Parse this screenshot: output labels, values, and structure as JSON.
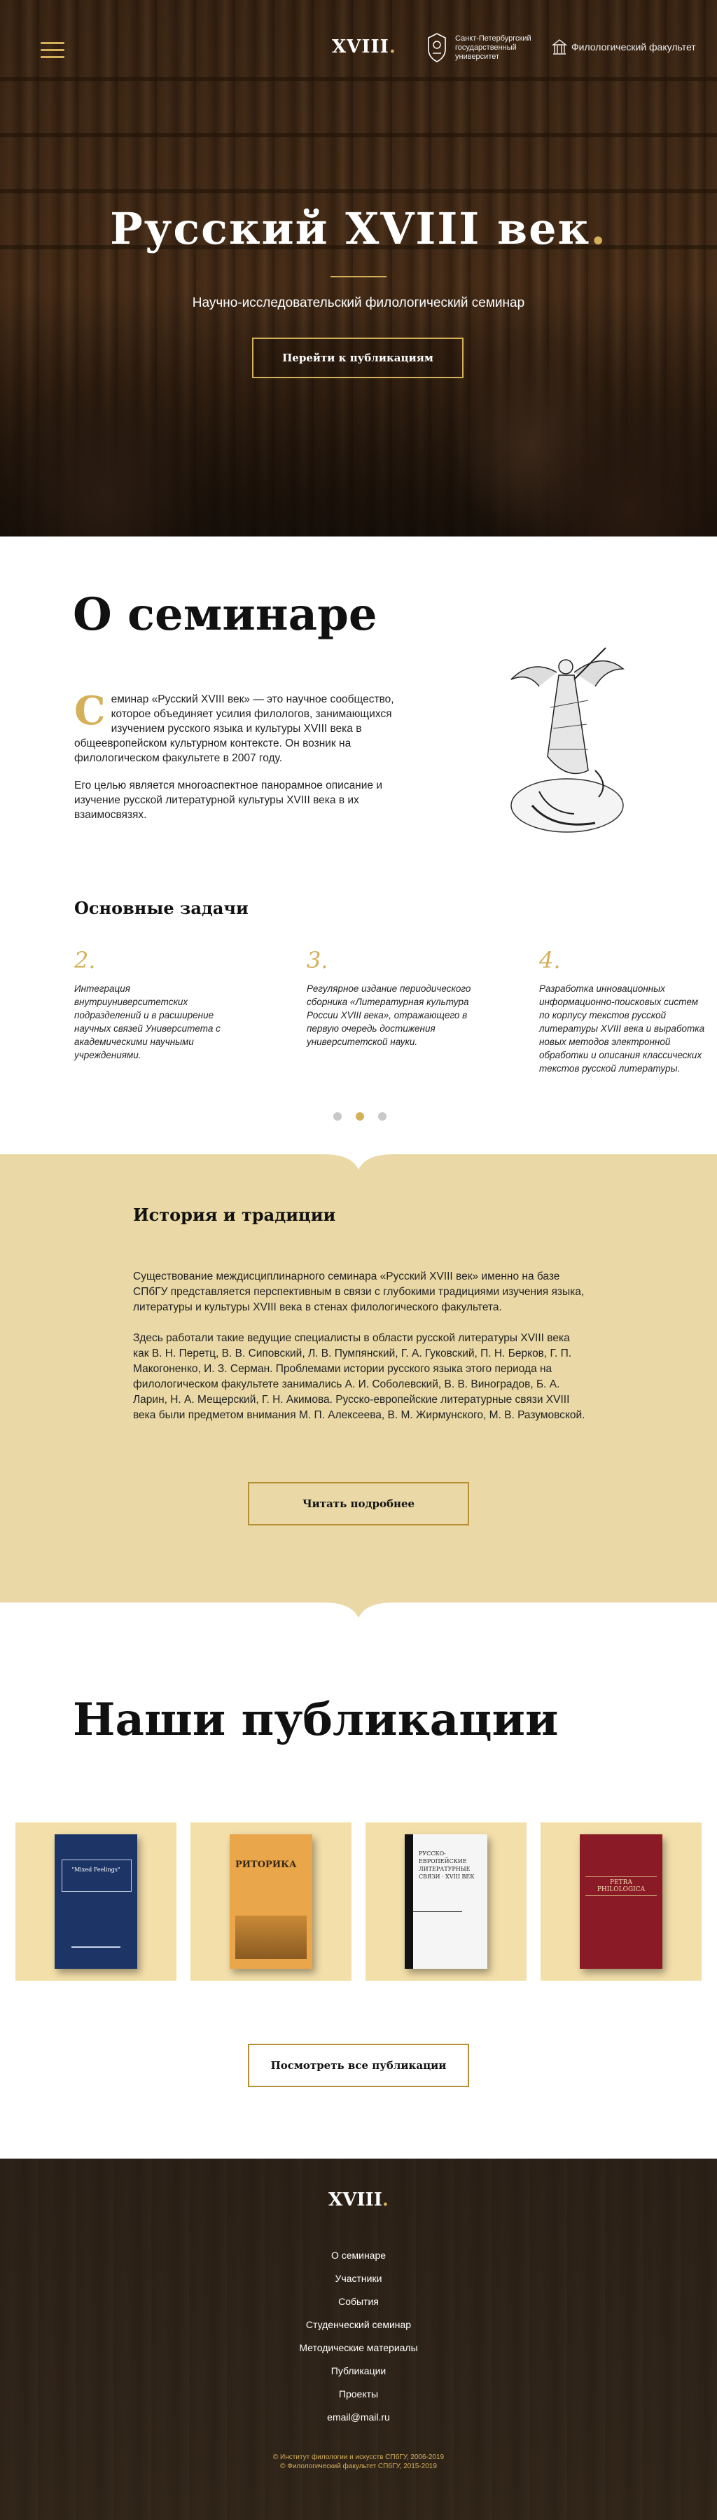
{
  "header": {
    "logo": "XVIII",
    "logo_dot": ".",
    "university": "Санкт-Петербургский государственный университет",
    "faculty": "Филологический факультет"
  },
  "hero": {
    "title": "Русский XVIII век",
    "title_dot": ".",
    "subtitle": "Научно-исследовательский филологический семинар",
    "button": "Перейти к публикациям"
  },
  "about": {
    "title": "О семинаре",
    "dropcap": "С",
    "para1": "еминар «Русский XVIII век» — это научное сообщество, которое объединяет усилия филологов, занимающихся изучением русского языка и культуры XVIII века в общеевропейском культурном контексте. Он возник на филологическом факультете в 2007 году.",
    "para2": "Его целью является многоаспектное панорамное описание и изучение русской литературной культуры XVIII века в их взаимосвязях.",
    "tasks_title": "Основные задачи",
    "tasks": [
      {
        "num": "2.",
        "text": "Интеграция внутриуниверситетских подразделений и в расширение научных связей Университета с академическими научными учреждениями."
      },
      {
        "num": "3.",
        "text": "Регулярное издание периодического сборника «Литературная культура России XVIII века», отражающего в первую очередь достижения университетской науки."
      },
      {
        "num": "4.",
        "text": "Разработка инновационных информационно-поисковых систем по корпусу текстов русской литературы XVIII века и выработка новых методов электронной обработки и описания классических текстов русской литературы."
      }
    ]
  },
  "history": {
    "title": "История и традиции",
    "para1": "Существование междисциплинарного семинара «Русский XVIII век» именно на базе СПбГУ представляется перспективным в связи с глубокими традициями изучения языка, литературы и культуры XVIII века в стенах филологического факультета.",
    "para2": "Здесь работали такие ведущие специалисты в области русской литературы XVIII века как В. Н. Перетц, В. В. Сиповский, Л. В. Пумпянский, Г. А. Гуковский, П. Н. Берков, Г. П. Макогоненко, И. З. Серман. Проблемами истории русского языка этого периода на филологическом факультете занимались А. И. Соболевский, В. В. Виноградов, Б. А. Ларин, Н. А. Мещерский, Г. Н. Акимова. Русско-европейские литературные связи XVIII века были предметом внимания М. П. Алексеева, В. М. Жирмунского, М. В. Разумовской.",
    "button": "Читать подробнее"
  },
  "publications": {
    "title": "Наши публикации",
    "books": [
      {
        "title": "\"Mixed Feelings\"",
        "cover": "#1d3566"
      },
      {
        "title": "РИТОРИКА",
        "cover": "#e9a64a"
      },
      {
        "title": "РУССКО-ЕВРОПЕЙСКИЕ ЛИТЕРАТУРНЫЕ СВЯЗИ · XVIII ВЕК",
        "cover": "#f5f5f5"
      },
      {
        "title": "PETRA PHILOLOGICA",
        "cover": "#8a1b26"
      }
    ],
    "button": "Посмотреть все публикации"
  },
  "footer": {
    "logo": "XVIII",
    "logo_dot": ".",
    "nav": [
      "О семинаре",
      "Участники",
      "События",
      "Студенческий семинар",
      "Методические материалы",
      "Публикации",
      "Проекты",
      "email@mail.ru"
    ],
    "copy1": "© Институт филологии и искусств СПбГУ, 2006-2019",
    "copy2": "© Филологический факультет СПбГУ, 2015-2019"
  },
  "colors": {
    "accent": "#d4b05a",
    "history_bg": "#ead9a6",
    "pub_card": "#f3dfaa"
  }
}
